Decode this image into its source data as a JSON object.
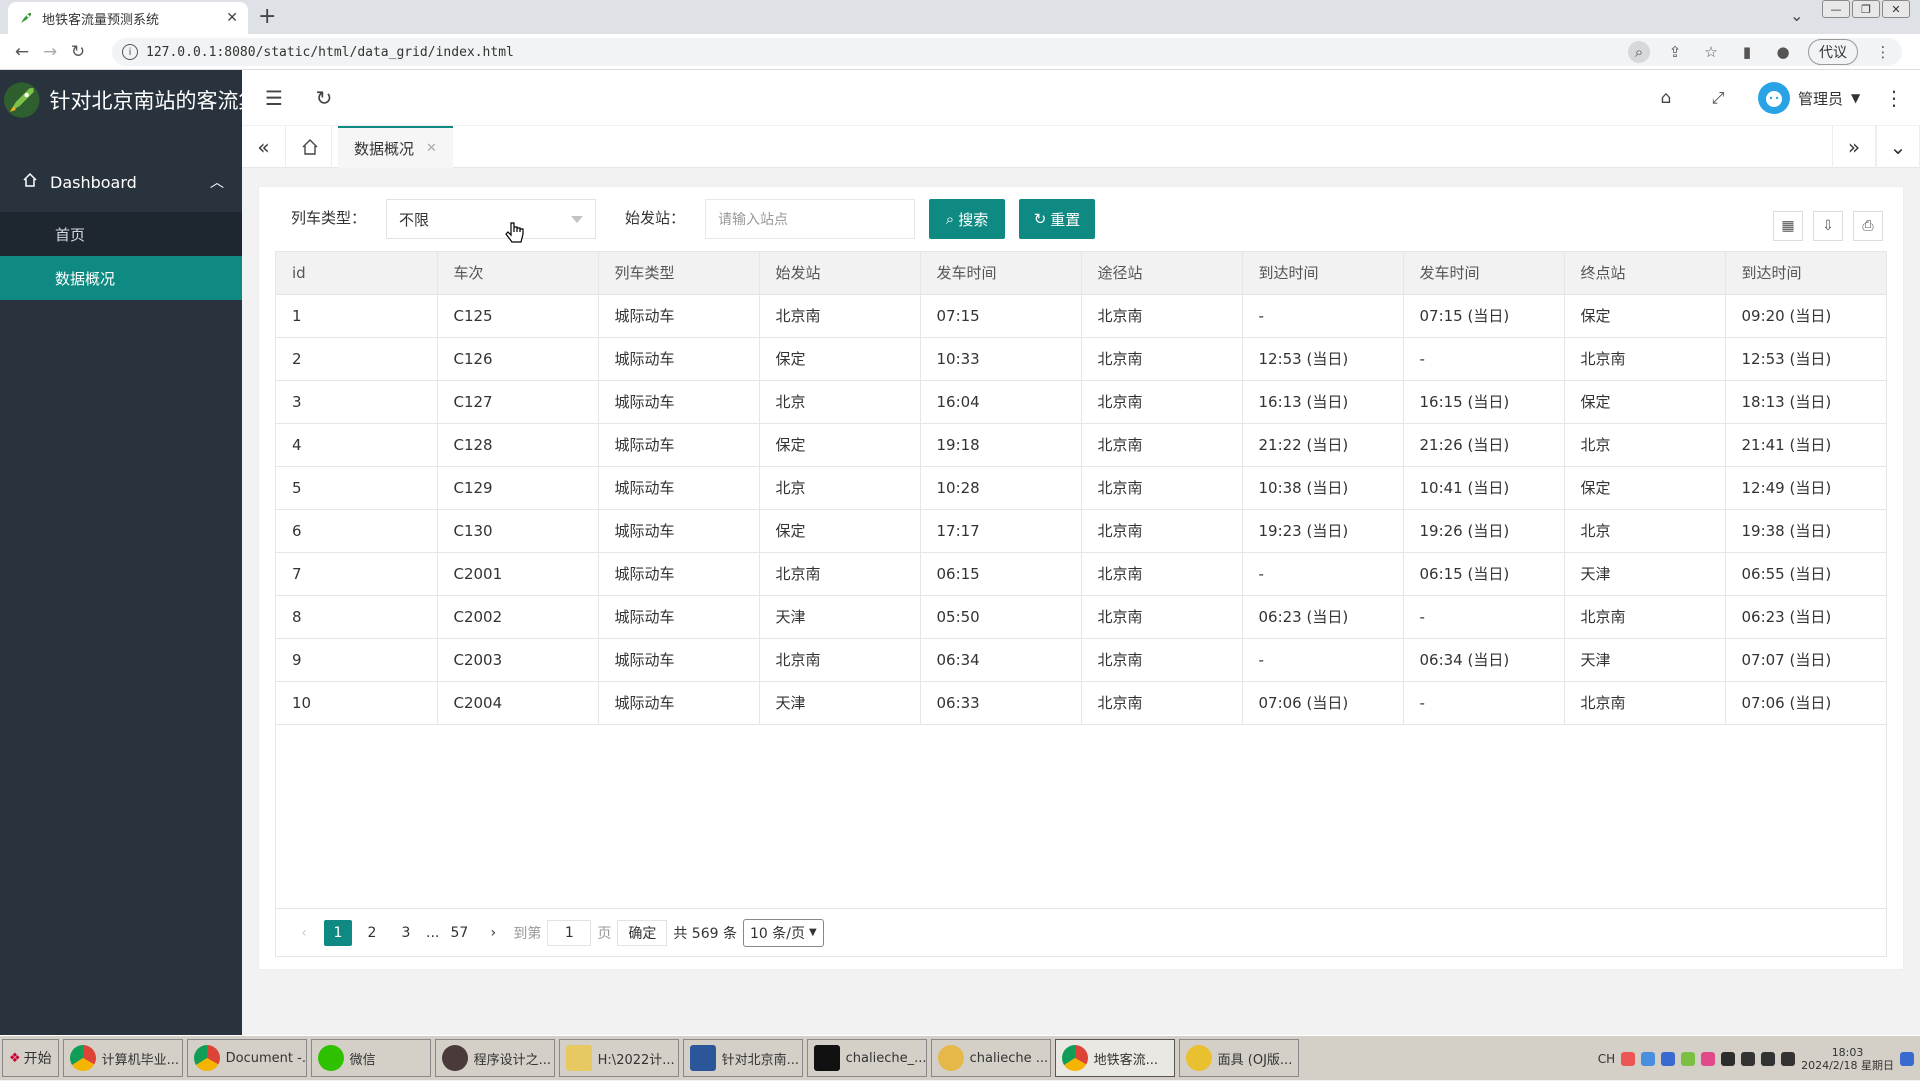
{
  "browser": {
    "tab_title": "地铁客流量预测系统",
    "url": "127.0.0.1:8080/static/html/data_grid/index.html",
    "profile_label": "代议"
  },
  "app": {
    "title": "针对北京南站的客流集",
    "accent": "#0f8a82",
    "sidebar_bg": "#28333e",
    "menu": {
      "group_label": "Dashboard",
      "items": [
        {
          "label": "首页"
        },
        {
          "label": "数据概况"
        }
      ]
    },
    "user_label": "管理员",
    "page_tab": "数据概况"
  },
  "filters": {
    "train_type_label": "列车类型：",
    "train_type_value": "不限",
    "origin_label": "始发站：",
    "origin_placeholder": "请输入站点",
    "search_label": "搜索",
    "reset_label": "重置"
  },
  "table": {
    "columns": [
      "id",
      "车次",
      "列车类型",
      "始发站",
      "发车时间",
      "途径站",
      "到达时间",
      "发车时间",
      "终点站",
      "到达时间"
    ],
    "rows": [
      [
        "1",
        "C125",
        "城际动车",
        "北京南",
        "07:15",
        "北京南",
        "-",
        "07:15 (当日)",
        "保定",
        "09:20 (当日)"
      ],
      [
        "2",
        "C126",
        "城际动车",
        "保定",
        "10:33",
        "北京南",
        "12:53 (当日)",
        "-",
        "北京南",
        "12:53 (当日)"
      ],
      [
        "3",
        "C127",
        "城际动车",
        "北京",
        "16:04",
        "北京南",
        "16:13 (当日)",
        "16:15 (当日)",
        "保定",
        "18:13 (当日)"
      ],
      [
        "4",
        "C128",
        "城际动车",
        "保定",
        "19:18",
        "北京南",
        "21:22 (当日)",
        "21:26 (当日)",
        "北京",
        "21:41 (当日)"
      ],
      [
        "5",
        "C129",
        "城际动车",
        "北京",
        "10:28",
        "北京南",
        "10:38 (当日)",
        "10:41 (当日)",
        "保定",
        "12:49 (当日)"
      ],
      [
        "6",
        "C130",
        "城际动车",
        "保定",
        "17:17",
        "北京南",
        "19:23 (当日)",
        "19:26 (当日)",
        "北京",
        "19:38 (当日)"
      ],
      [
        "7",
        "C2001",
        "城际动车",
        "北京南",
        "06:15",
        "北京南",
        "-",
        "06:15 (当日)",
        "天津",
        "06:55 (当日)"
      ],
      [
        "8",
        "C2002",
        "城际动车",
        "天津",
        "05:50",
        "北京南",
        "06:23 (当日)",
        "-",
        "北京南",
        "06:23 (当日)"
      ],
      [
        "9",
        "C2003",
        "城际动车",
        "北京南",
        "06:34",
        "北京南",
        "-",
        "06:34 (当日)",
        "天津",
        "07:07 (当日)"
      ],
      [
        "10",
        "C2004",
        "城际动车",
        "天津",
        "06:33",
        "北京南",
        "07:06 (当日)",
        "-",
        "北京南",
        "07:06 (当日)"
      ]
    ]
  },
  "pager": {
    "pages": [
      "1",
      "2",
      "3"
    ],
    "ellipsis": "...",
    "last_page": "57",
    "goto_label": "到第",
    "goto_value": "1",
    "page_unit": "页",
    "confirm_label": "确定",
    "total_label": "共 569 条",
    "limit_label": "10 条/页"
  },
  "taskbar": {
    "start_label": "开始",
    "tasks": [
      "计算机毕业...",
      "Document -...",
      "微信",
      "程序设计之...",
      "H:\\2022计...",
      "针对北京南...",
      "chalieche_...",
      "chalieche ...",
      "地铁客流...",
      "面具 (OJ版..."
    ],
    "lang": "CH",
    "clock_time": "18:03",
    "clock_date": "2024/2/18 星期日"
  }
}
